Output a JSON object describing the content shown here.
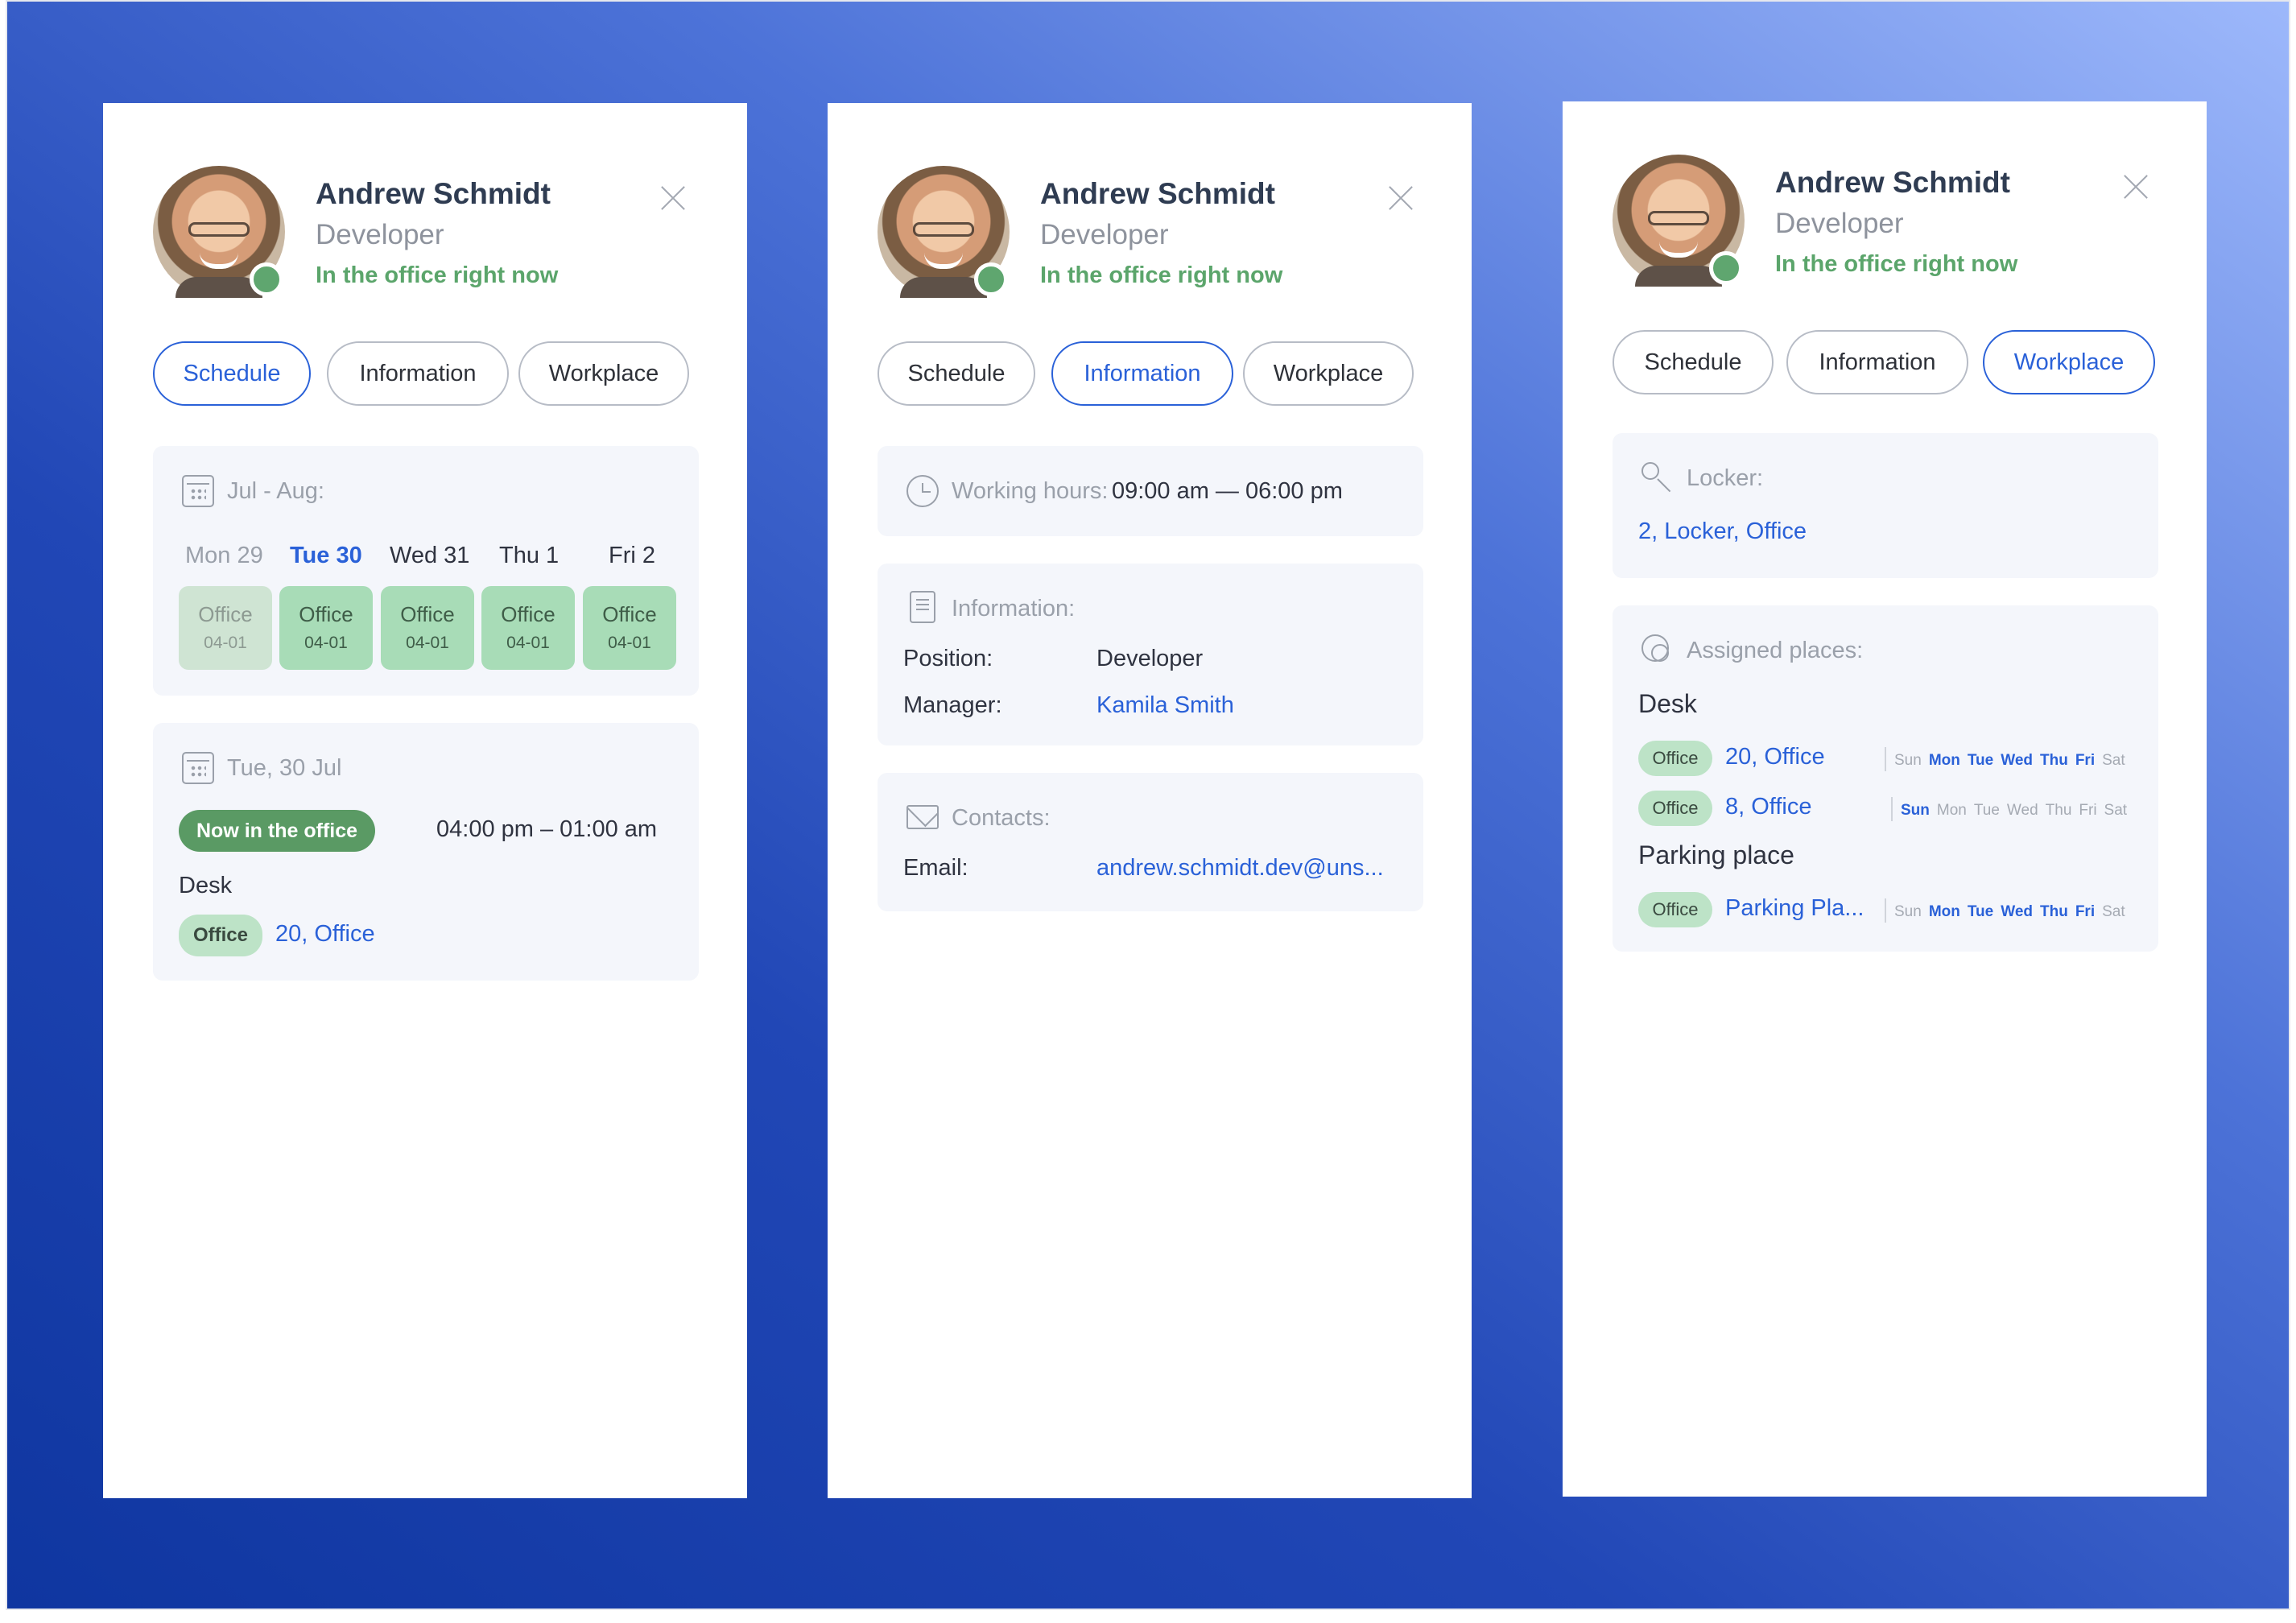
{
  "profile": {
    "name": "Andrew Schmidt",
    "role": "Developer",
    "presence": "In the office right now"
  },
  "tabs": [
    "Schedule",
    "Information",
    "Workplace"
  ],
  "schedule": {
    "range_label": "Jul - Aug:",
    "days": [
      {
        "label": "Mon 29",
        "state": "past",
        "office": "Office",
        "date": "04-01"
      },
      {
        "label": "Tue 30",
        "state": "today",
        "office": "Office",
        "date": "04-01"
      },
      {
        "label": "Wed 31",
        "state": "future",
        "office": "Office",
        "date": "04-01"
      },
      {
        "label": "Thu 1",
        "state": "future",
        "office": "Office",
        "date": "04-01"
      },
      {
        "label": "Fri 2",
        "state": "future",
        "office": "Office",
        "date": "04-01"
      }
    ],
    "day_detail": {
      "date_label": "Tue, 30 Jul",
      "status_badge": "Now in the office",
      "time_range": "04:00 pm – 01:00 am",
      "place_type": "Desk",
      "office_badge": "Office",
      "place_link": "20, Office"
    }
  },
  "information": {
    "working_hours_label": "Working hours:",
    "working_hours_value": "09:00 am — 06:00 pm",
    "info_label": "Information:",
    "position_label": "Position:",
    "position_value": "Developer",
    "manager_label": "Manager:",
    "manager_value": "Kamila Smith",
    "contacts_label": "Contacts:",
    "email_label": "Email:",
    "email_value": "andrew.schmidt.dev@uns..."
  },
  "workplace": {
    "locker_label": "Locker:",
    "locker_value": "2, Locker, Office",
    "assigned_label": "Assigned places:",
    "desk_title": "Desk",
    "parking_title": "Parking place",
    "weekday_names": [
      "Sun",
      "Mon",
      "Tue",
      "Wed",
      "Thu",
      "Fri",
      "Sat"
    ],
    "desk_places": [
      {
        "badge": "Office",
        "name": "20, Office",
        "active_days": [
          "Mon",
          "Tue",
          "Wed",
          "Thu",
          "Fri"
        ]
      },
      {
        "badge": "Office",
        "name": "8, Office",
        "active_days": [
          "Sun"
        ]
      }
    ],
    "parking_places": [
      {
        "badge": "Office",
        "name": "Parking Pla...",
        "active_days": [
          "Mon",
          "Tue",
          "Wed",
          "Thu",
          "Fri"
        ]
      }
    ]
  },
  "colors": {
    "accent": "#2a61d8",
    "status_green": "#5fa66f",
    "tile_green": "#a8dcb7",
    "background_start": "#0f36a0",
    "background_end": "#9db8fb"
  }
}
